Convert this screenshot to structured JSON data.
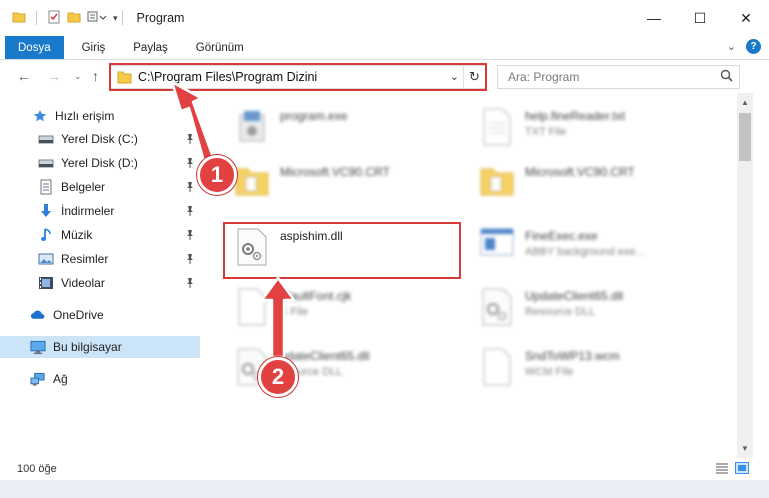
{
  "window": {
    "title": "Program",
    "controls": {
      "minimize": "—",
      "maximize": "☐",
      "close": "✕"
    }
  },
  "ribbon": {
    "tabs": [
      "Dosya",
      "Giriş",
      "Paylaş",
      "Görünüm"
    ],
    "accent": "#1979ca",
    "help": "?"
  },
  "navigation": {
    "address": "C:\\Program Files\\Program Dizini",
    "search_placeholder": "Ara: Program"
  },
  "sidebar": {
    "quick_access": "Hızlı erişim",
    "items": [
      {
        "label": "Yerel Disk (C:)",
        "icon": "drive-icon",
        "pinned": true
      },
      {
        "label": "Yerel Disk (D:)",
        "icon": "drive-icon",
        "pinned": true
      },
      {
        "label": "Belgeler",
        "icon": "documents-icon",
        "pinned": true
      },
      {
        "label": "İndirmeler",
        "icon": "downloads-icon",
        "pinned": true
      },
      {
        "label": "Müzik",
        "icon": "music-icon",
        "pinned": true
      },
      {
        "label": "Resimler",
        "icon": "pictures-icon",
        "pinned": true
      },
      {
        "label": "Videolar",
        "icon": "videos-icon",
        "pinned": true
      }
    ],
    "onedrive": "OneDrive",
    "this_pc": "Bu bilgisayar",
    "network": "Ağ"
  },
  "files": [
    {
      "name": "program.exe",
      "type": "",
      "icon": "installer-icon",
      "blurred": true
    },
    {
      "name": "help.fineReader.txt",
      "type": "TXT File",
      "icon": "text-file-icon",
      "blurred": true
    },
    {
      "name": "Microsoft.VC90.CRT",
      "type": "",
      "icon": "folder-icon",
      "blurred": true
    },
    {
      "name": "Microsoft.VC90.CRT",
      "type": "",
      "icon": "folder-icon",
      "blurred": true
    },
    {
      "name": "aspishim.dll",
      "type": "",
      "icon": "dll-gear-icon",
      "blurred": false,
      "highlighted": true
    },
    {
      "name": "FineExec.exe",
      "type": "ABBY background exe...",
      "icon": "exe-window-icon",
      "blurred": true
    },
    {
      "name": "efaultFont.cjk",
      "type": "K File",
      "icon": "blank-file-icon",
      "blurred": true
    },
    {
      "name": "UpdateClient65.dll",
      "type": "Resource DLL",
      "icon": "dll-gear-icon",
      "blurred": true
    },
    {
      "name": "pdateClient65.dll",
      "type": "esource DLL",
      "icon": "dll-gear-icon",
      "blurred": true
    },
    {
      "name": "SndToWP13.wcm",
      "type": "WCM File",
      "icon": "blank-file-icon",
      "blurred": true
    }
  ],
  "status": {
    "item_count": "100 öğe"
  },
  "annotations": {
    "color": "#e24141",
    "step1": "1",
    "step2": "2"
  }
}
